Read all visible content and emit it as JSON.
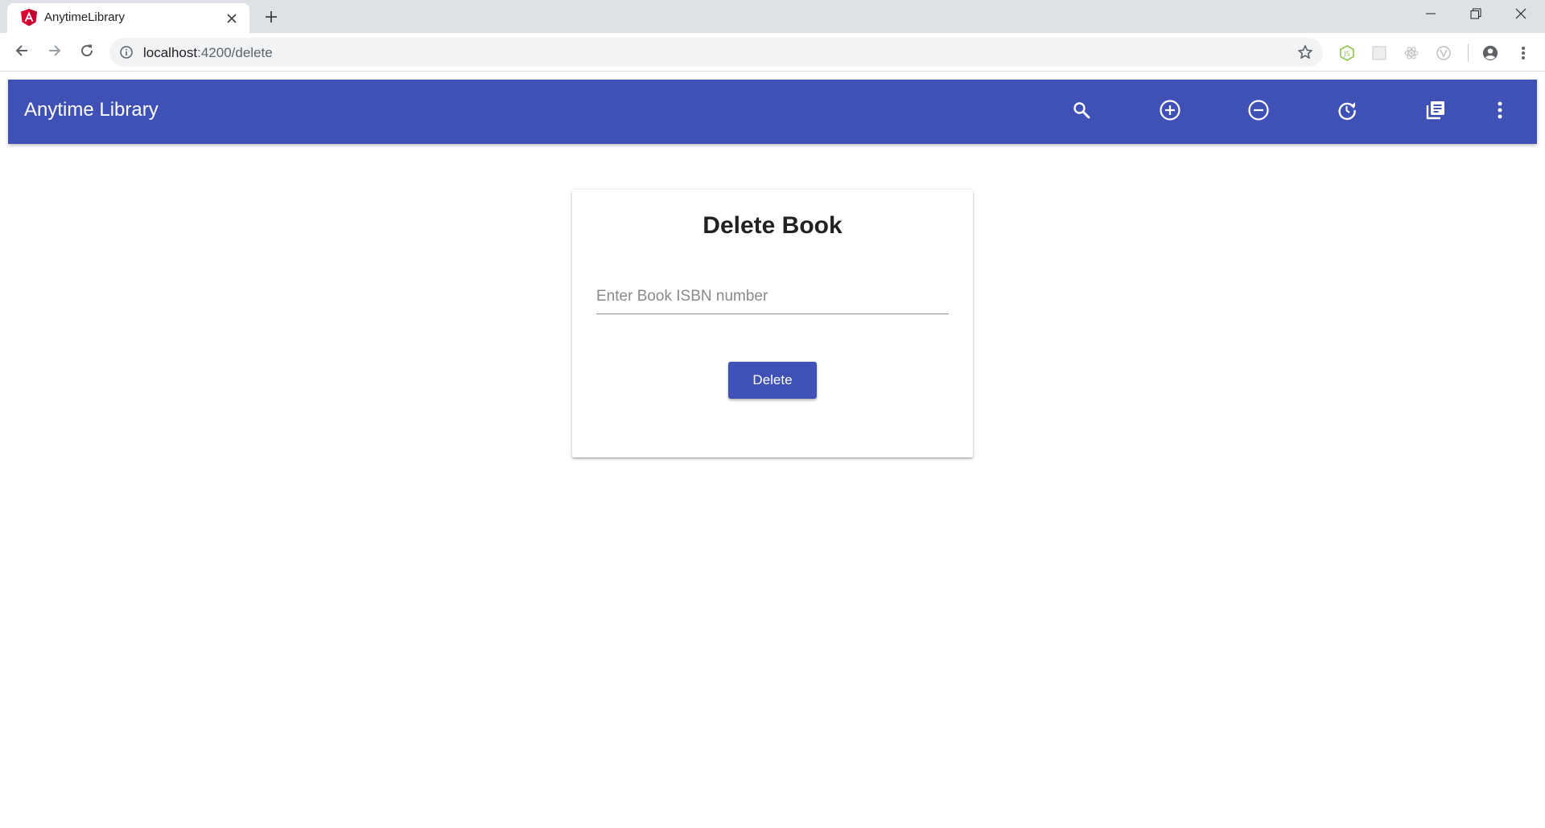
{
  "browser": {
    "tab_title": "AnytimeLibrary",
    "url_host": "localhost",
    "url_path": ":4200/delete",
    "accent": "#dee1e6",
    "icons": {
      "favicon": "angular-icon",
      "tab_close": "close-icon",
      "new_tab": "plus-icon",
      "minimize": "minimize-icon",
      "maximize": "restore-icon",
      "close": "close-icon",
      "back": "arrow-left-icon",
      "forward": "arrow-right-icon",
      "reload": "reload-icon",
      "info": "info-icon",
      "bookmark": "star-icon",
      "extensions": [
        "nodejs-icon",
        "extension-icon",
        "react-icon",
        "vue-icon"
      ],
      "profile": "account-icon",
      "menu": "more-vert-icon"
    }
  },
  "app": {
    "title": "Anytime Library",
    "brand_color": "#3f51b5",
    "toolbar_icons": [
      "search-icon",
      "add-circle-icon",
      "remove-circle-icon",
      "history-icon",
      "library-books-icon",
      "more-vert-icon"
    ]
  },
  "form": {
    "heading": "Delete Book",
    "isbn_placeholder": "Enter Book ISBN number",
    "isbn_value": "",
    "submit_label": "Delete"
  }
}
